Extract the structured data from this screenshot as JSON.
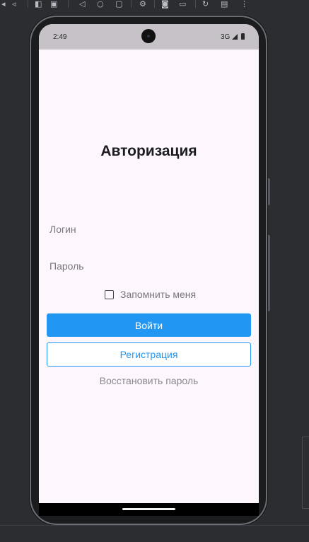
{
  "ide_toolbar": {
    "icons": [
      "volume-icon",
      "layout-inspector-icon",
      "back-icon",
      "home-icon",
      "overview-icon",
      "settings-icon",
      "camera-icon",
      "video-icon",
      "rotate-icon",
      "display-icon",
      "more-icon"
    ],
    "more_label": "⋮"
  },
  "status_bar": {
    "time": "2:49",
    "network": "3G"
  },
  "login": {
    "title": "Авторизация",
    "login_placeholder": "Логин",
    "password_placeholder": "Пароль",
    "remember_me": "Запомнить меня",
    "login_button": "Войти",
    "register_button": "Регистрация",
    "restore_link": "Восстановить пароль"
  },
  "colors": {
    "primary": "#2196f3",
    "screen_background": "#fdf7fd",
    "ide_background": "#2b2d31"
  }
}
